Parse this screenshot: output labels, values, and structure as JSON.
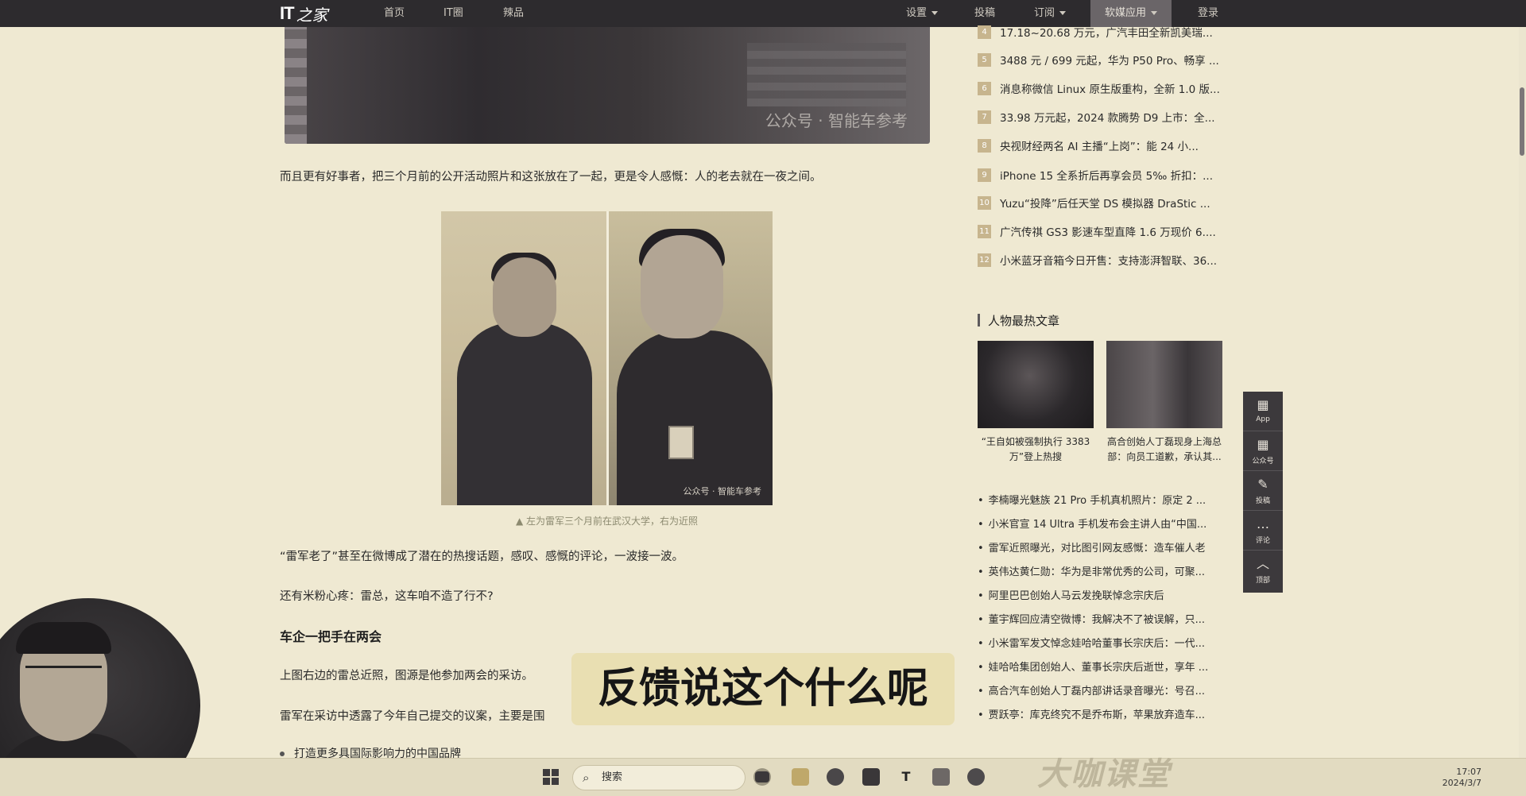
{
  "header": {
    "logo_it": "IT",
    "logo_cn": "之家",
    "nav": [
      "首页",
      "IT圈",
      "辣品"
    ],
    "right_nav": [
      {
        "label": "设置",
        "dropdown": true
      },
      {
        "label": "投稿",
        "dropdown": false
      },
      {
        "label": "订阅",
        "dropdown": true
      },
      {
        "label": "软媒应用",
        "dropdown": true,
        "active": true
      },
      {
        "label": "登录",
        "dropdown": false
      }
    ]
  },
  "article": {
    "top_image_watermark": "公众号 · 智能车参考",
    "para1": "而且更有好事者，把三个月前的公开活动照片和这张放在了一起，更是令人感慨：人的老去就在一夜之间。",
    "pair_image_watermark": "公众号 · 智能车参考",
    "caption": "▲ 左为雷军三个月前在武汉大学，右为近照",
    "para2": "“雷军老了”甚至在微博成了潜在的热搜话题，感叹、感慨的评论，一波接一波。",
    "para3": "还有米粉心疼：雷总，这车咱不造了行不?",
    "heading": "车企一把手在两会",
    "para4": "上图右边的雷总近照，图源是他参加两会的采访。",
    "para5": "雷军在采访中透露了今年自己提交的议案，主要是围",
    "bullet1": "打造更多具国际影响力的中国品牌"
  },
  "ranking": [
    {
      "num": "4",
      "title": "17.18~20.68 万元，广汽丰田全新凯美瑞..."
    },
    {
      "num": "5",
      "title": "3488 元 / 699 元起，华为 P50 Pro、畅享 ..."
    },
    {
      "num": "6",
      "title": "消息称微信 Linux 原生版重构，全新 1.0 版..."
    },
    {
      "num": "7",
      "title": "33.98 万元起，2024 款腾势 D9 上市：全..."
    },
    {
      "num": "8",
      "title": "央视财经两名 AI 主播“上岗”：能 24 小..."
    },
    {
      "num": "9",
      "title": "iPhone 15 全系折后再享会员 5‰ 折扣：..."
    },
    {
      "num": "10",
      "title": "Yuzu“投降”后任天堂 DS 模拟器 DraStic ..."
    },
    {
      "num": "11",
      "title": "广汽传祺 GS3 影速车型直降 1.6 万现价 6...."
    },
    {
      "num": "12",
      "title": "小米蓝牙音箱今日开售：支持澎湃智联、36..."
    }
  ],
  "people_section": {
    "title": "人物最热文章",
    "cards": [
      {
        "caption": "“王自如被强制执行 3383 万”登上热搜"
      },
      {
        "caption": "高合创始人丁磊现身上海总部：向员工道歉，承认其..."
      }
    ],
    "list": [
      "李楠曝光魅族 21 Pro 手机真机照片：原定 2 ...",
      "小米官宣 14 Ultra 手机发布会主讲人由“中国...",
      "雷军近照曝光，对比图引网友感慨：造车催人老",
      "英伟达黄仁勋：华为是非常优秀的公司，可聚...",
      "阿里巴巴创始人马云发挽联悼念宗庆后",
      "董宇辉回应清空微博：我解决不了被误解，只...",
      "小米雷军发文悼念娃哈哈董事长宗庆后：一代...",
      "娃哈哈集团创始人、董事长宗庆后逝世，享年 ...",
      "高合汽车创始人丁磊内部讲话录音曝光：号召...",
      "贾跃亭：库克终究不是乔布斯，苹果放弃造车..."
    ]
  },
  "side_tools": [
    "App",
    "公众号",
    "投稿",
    "评论",
    "顶部"
  ],
  "subtitle": "反馈说这个什么呢",
  "brand": "大咖课堂",
  "taskbar": {
    "search_placeholder": "搜索",
    "time": "17:07",
    "date": "2024/3/7"
  }
}
